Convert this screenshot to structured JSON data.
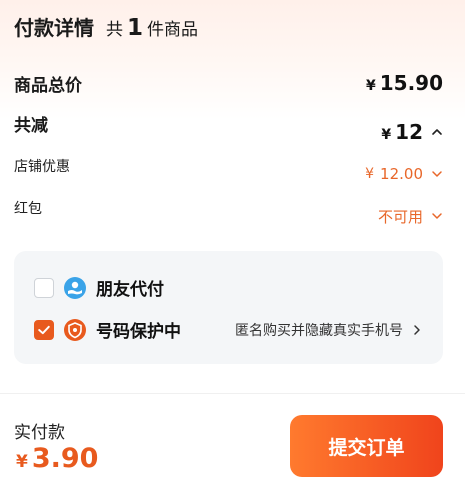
{
  "header": {
    "title": "付款详情",
    "count_prefix": "共",
    "count": "1",
    "count_suffix": "件商品"
  },
  "summary": {
    "goods_total": {
      "label": "商品总价",
      "currency": "¥",
      "amount": "15.90"
    },
    "discount_total": {
      "label": "共减",
      "currency": "¥",
      "amount": "12"
    },
    "shop_discount": {
      "label": "店铺优惠",
      "currency": "¥",
      "amount": "12.00"
    },
    "red_packet": {
      "label": "红包",
      "value": "不可用"
    }
  },
  "options": {
    "friend_pay": {
      "label": "朋友代付",
      "checked": false,
      "icon": "hand-coin-icon"
    },
    "number_protection": {
      "label": "号码保护中",
      "checked": true,
      "icon": "phone-shield-icon",
      "link_text": "匿名购买并隐藏真实手机号"
    }
  },
  "footer": {
    "actual_label": "实付款",
    "currency": "¥",
    "amount": "3.90",
    "submit_label": "提交订单"
  },
  "colors": {
    "accent": "#e85a1e",
    "accent_text": "#e8672a",
    "card_bg": "#f4f6f8",
    "friend_icon": "#3aa3e8"
  }
}
